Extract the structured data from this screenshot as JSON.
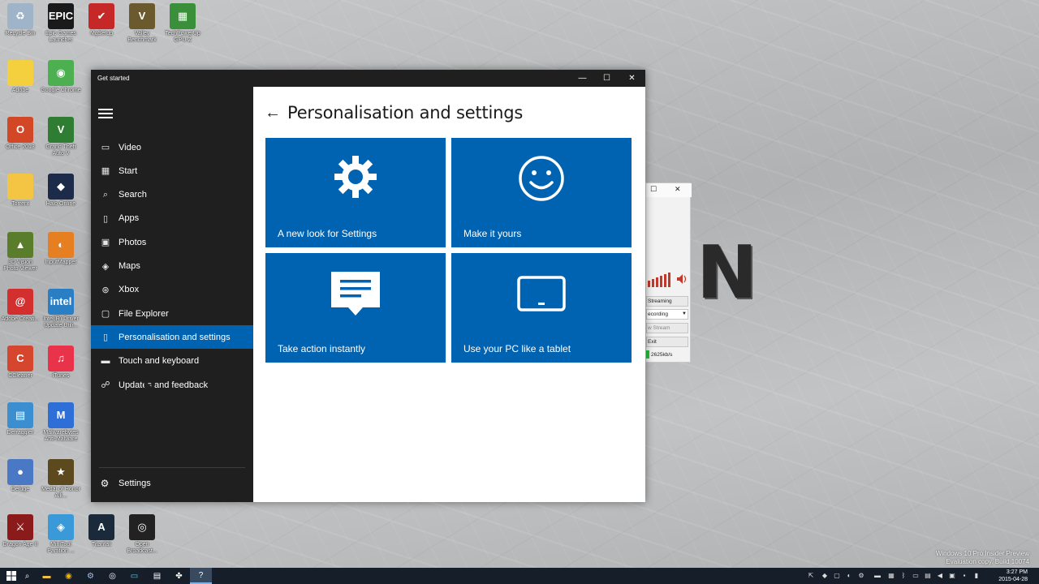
{
  "desktop": {
    "icons": [
      {
        "label": "Recycle Bin",
        "color": "#9fb4c8",
        "glyph": "♻"
      },
      {
        "label": "Epic Games Launcher",
        "color": "#1a1a1a",
        "glyph": "EPIC"
      },
      {
        "label": "MgSetup",
        "color": "#c62828",
        "glyph": "✔"
      },
      {
        "label": "Valley Benchmark",
        "color": "#6b5a2e",
        "glyph": "V"
      },
      {
        "label": "TechPowerUp GPU-Z",
        "color": "#3a8f3a",
        "glyph": "▦"
      },
      {
        "label": "Adobe",
        "color": "#f4d03f",
        "glyph": ""
      },
      {
        "label": "Google Chrome",
        "color": "#4caf50",
        "glyph": "◉"
      },
      {
        "label": "Office 2013",
        "color": "#d24726",
        "glyph": "O"
      },
      {
        "label": "Grand Theft Auto V",
        "color": "#2e7d32",
        "glyph": "V"
      },
      {
        "label": "Torrent",
        "color": "#f4c542",
        "glyph": ""
      },
      {
        "label": "Halo Online",
        "color": "#1c2b4a",
        "glyph": "◆"
      },
      {
        "label": "3D Vision Photo Viewer",
        "color": "#5a7d2c",
        "glyph": "▲"
      },
      {
        "label": "InputMapper",
        "color": "#e67e22",
        "glyph": "◐"
      },
      {
        "label": "Adobe Creati...",
        "color": "#d32f2f",
        "glyph": "@"
      },
      {
        "label": "Intel(R) Driver Update Utili...",
        "color": "#2a7fc4",
        "glyph": "intel"
      },
      {
        "label": "CCleaner",
        "color": "#d6452e",
        "glyph": "C"
      },
      {
        "label": "iTunes",
        "color": "#e8334a",
        "glyph": "♫"
      },
      {
        "label": "Defraggler",
        "color": "#3b8ed0",
        "glyph": "▤"
      },
      {
        "label": "Malwarebytes Anti-Malware",
        "color": "#2d6fd6",
        "glyph": "M"
      },
      {
        "label": "Deluge",
        "color": "#4a78c4",
        "glyph": "●"
      },
      {
        "label": "Medal of Honor Alli...",
        "color": "#5c4a1e",
        "glyph": "★"
      },
      {
        "label": "Dragon Age II",
        "color": "#8b1a1a",
        "glyph": "⚔"
      },
      {
        "label": "MiniTool Partition ...",
        "color": "#3a9ad9",
        "glyph": "◈"
      },
      {
        "label": "Titanfall",
        "color": "#1a2a3a",
        "glyph": "A"
      },
      {
        "label": "Open Broadcast...",
        "color": "#222222",
        "glyph": "◎"
      }
    ]
  },
  "window": {
    "title": "Get started",
    "controls": {
      "minimize": "—",
      "maximize": "☐",
      "close": "✕"
    }
  },
  "sidebar": {
    "items": [
      {
        "label": "Video",
        "icon": "video-icon"
      },
      {
        "label": "Start",
        "icon": "start-grid-icon"
      },
      {
        "label": "Search",
        "icon": "search-icon"
      },
      {
        "label": "Apps",
        "icon": "apps-icon"
      },
      {
        "label": "Photos",
        "icon": "photos-icon"
      },
      {
        "label": "Maps",
        "icon": "maps-icon"
      },
      {
        "label": "Xbox",
        "icon": "xbox-icon"
      },
      {
        "label": "File Explorer",
        "icon": "file-explorer-icon"
      },
      {
        "label": "Personalisation and settings",
        "icon": "personalisation-icon",
        "active": true
      },
      {
        "label": "Touch and keyboard",
        "icon": "keyboard-icon"
      },
      {
        "label": "Updates and feedback",
        "icon": "feedback-icon"
      }
    ],
    "settings_label": "Settings"
  },
  "content": {
    "title": "Personalisation and settings",
    "tiles": [
      {
        "label": "A new look for Settings",
        "icon": "gear-icon"
      },
      {
        "label": "Make it yours",
        "icon": "smiley-icon"
      },
      {
        "label": "Take action instantly",
        "icon": "action-center-icon"
      },
      {
        "label": "Use your PC like a tablet",
        "icon": "tablet-icon"
      }
    ],
    "accent": "#0063b1"
  },
  "obs_window": {
    "close": "✕",
    "maximize": "☐",
    "streaming": "Streaming",
    "recording": "ecording",
    "preview": "w Stream",
    "exit": "Exit",
    "bitrate": "2625kb/s"
  },
  "taskbar": {
    "time": "3:27 PM",
    "date": "2015-04-28"
  },
  "watermark": {
    "line1": "Windows 10 Pro Insider Preview",
    "line2": "Evaluation copy. Build 10074"
  }
}
